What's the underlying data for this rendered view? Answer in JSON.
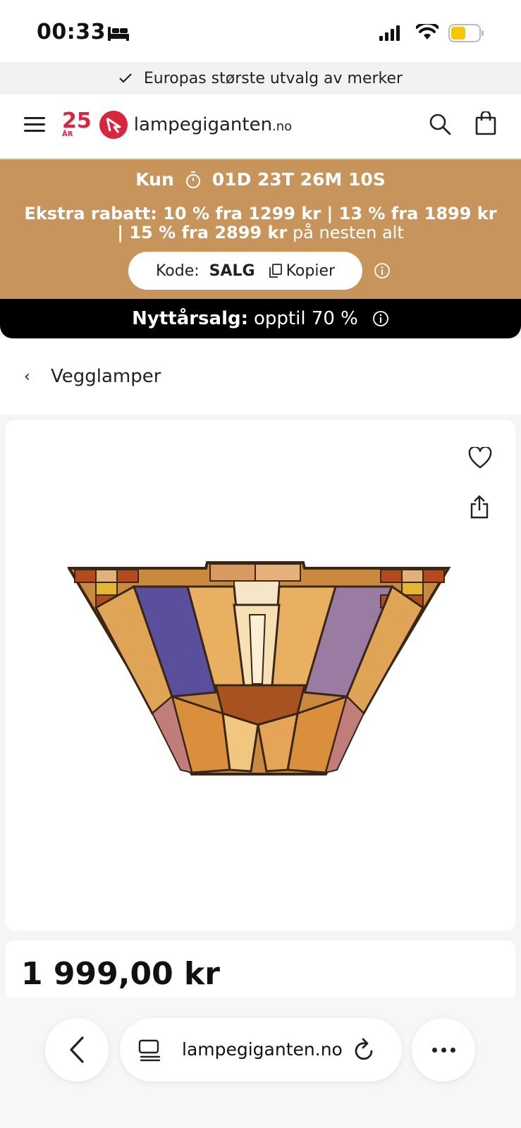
{
  "status_bar": {
    "time": "00:33"
  },
  "promo": {
    "text": "Europas største utvalg av merker"
  },
  "header": {
    "logo_anniversary": "25",
    "logo_anniversary_sub": "ÅR",
    "logo_name": "lampegiganten",
    "logo_tld": ".no"
  },
  "campaign": {
    "countdown_prefix": "Kun",
    "countdown": "01D 23T 26M 10S",
    "offer_bold": "Ekstra rabatt: 10 % fra 1299 kr | 13 % fra 1899 kr | 15 % fra 2899 kr",
    "offer_rest": " på nesten alt",
    "code_label": "Kode:",
    "code_value": "SALG",
    "copy_label": "Kopier"
  },
  "sale_banner": {
    "bold": "Nyttårsalg:",
    "text": "opptil 70 %"
  },
  "breadcrumb": {
    "back_label": "Vegglamper"
  },
  "product": {
    "price": "1 999,00 kr"
  },
  "browser": {
    "url": "lampegiganten.no"
  },
  "colors": {
    "campaign_bg": "#c7955c",
    "brand_red": "#d8263f",
    "sale_bg": "#000000"
  }
}
